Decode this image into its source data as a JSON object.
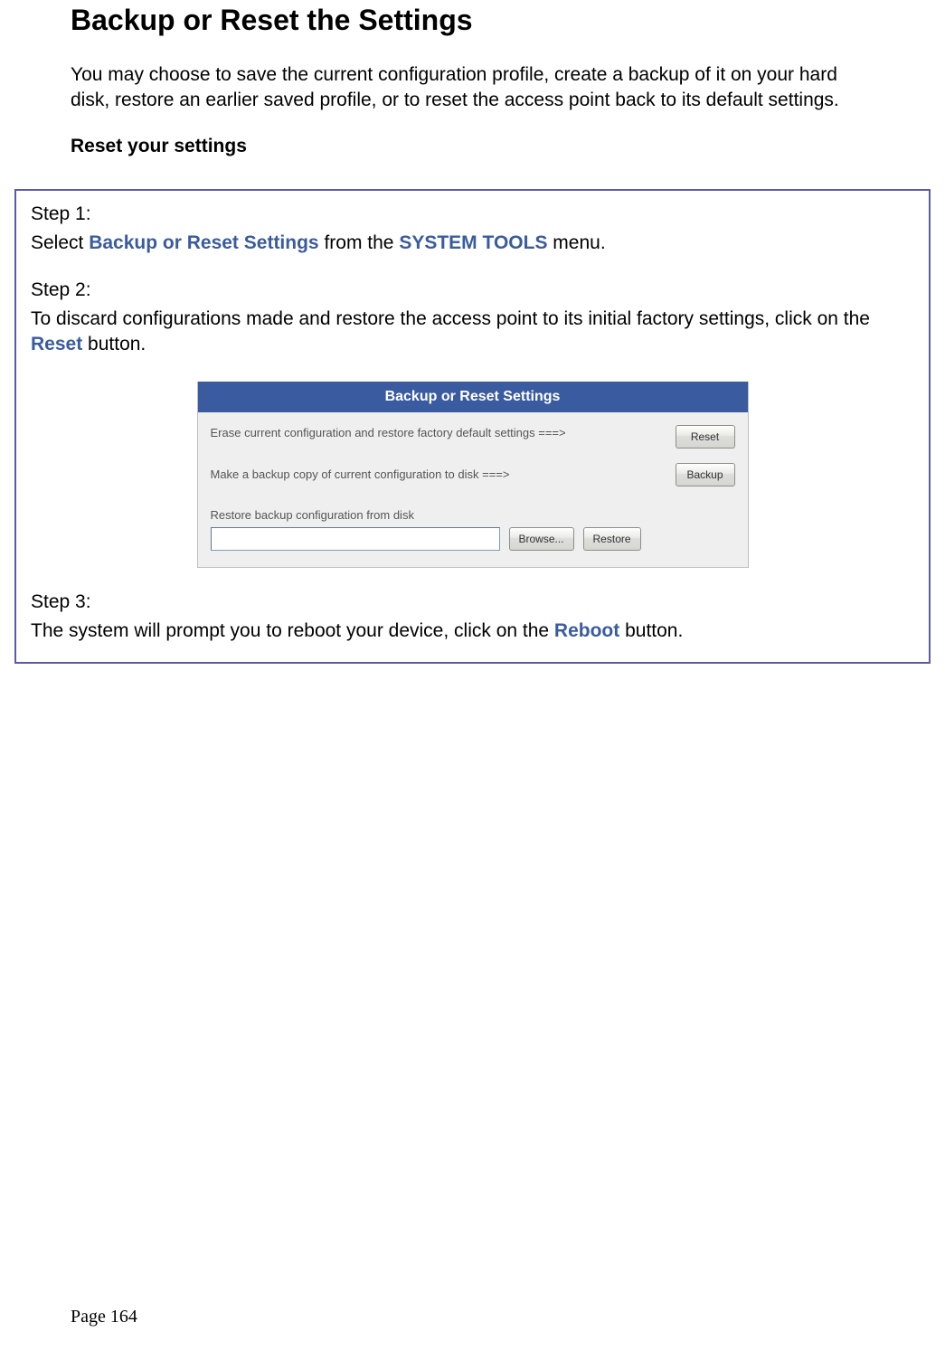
{
  "title": "Backup or Reset the Settings",
  "intro": "You may choose to save the current configuration profile, create a backup of it on your hard disk, restore an earlier saved profile, or to reset the access point back to its default settings.",
  "subheading": "Reset your settings",
  "steps": {
    "s1_label": "Step 1:",
    "s1_prefix": "Select ",
    "s1_link": "Backup or Reset Settings",
    "s1_mid": " from the ",
    "s1_menu": "SYSTEM TOOLS",
    "s1_suffix": " menu.",
    "s2_label": "Step 2:",
    "s2_prefix": "To discard configurations made and restore the access point to its initial factory settings, click on the ",
    "s2_link": "Reset",
    "s2_suffix": " button.",
    "s3_label": "Step 3:",
    "s3_prefix": "The system will prompt you to reboot your device, click on the ",
    "s3_link": "Reboot",
    "s3_suffix": " button."
  },
  "widget": {
    "title": "Backup or Reset Settings",
    "row1_text": "Erase current configuration and restore factory default settings ===>",
    "reset_label": "Reset",
    "row2_text": "Make a backup copy of current configuration to disk ===>",
    "backup_label": "Backup",
    "row3_label": "Restore backup configuration from disk",
    "browse_label": "Browse...",
    "restore_label": "Restore",
    "file_value": ""
  },
  "page_num": "Page 164"
}
